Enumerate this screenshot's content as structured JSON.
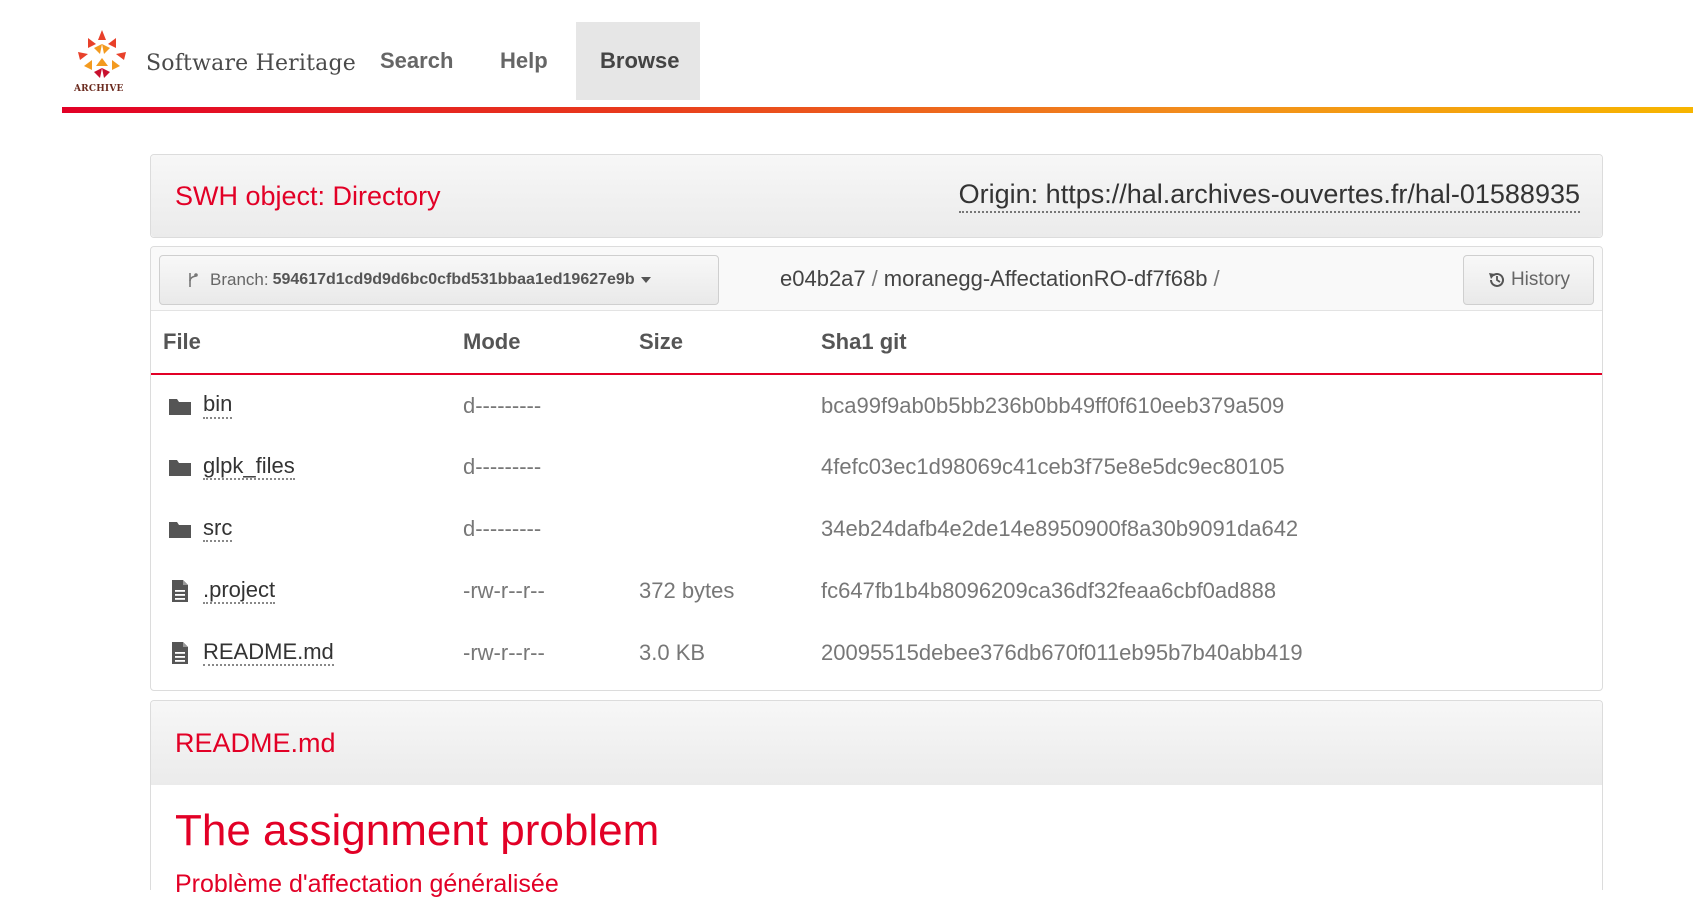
{
  "nav": {
    "brand_logo_text": "ARCHIVE",
    "brand_name": "Software Heritage",
    "items": [
      {
        "label": "Search",
        "active": false
      },
      {
        "label": "Help",
        "active": false
      },
      {
        "label": "Browse",
        "active": true
      }
    ]
  },
  "object": {
    "title": "SWH object: Directory",
    "origin": "Origin: https://hal.archives-ouvertes.fr/hal-01588935"
  },
  "toolbar": {
    "branch_prefix": "Branch:",
    "branch_id": "594617d1cd9d9d6bc0cfbd531bbaa1ed19627e9b",
    "breadcrumb": [
      "e04b2a7",
      "moranegg-AffectationRO-df7f68b"
    ],
    "breadcrumb_sep": "/",
    "history_label": "History"
  },
  "listing": {
    "headers": {
      "file": "File",
      "mode": "Mode",
      "size": "Size",
      "sha": "Sha1 git"
    },
    "rows": [
      {
        "type": "folder",
        "name": "bin",
        "mode": "d---------",
        "size": "",
        "sha": "bca99f9ab0b5bb236b0bb49ff0f610eeb379a509"
      },
      {
        "type": "folder",
        "name": "glpk_files",
        "mode": "d---------",
        "size": "",
        "sha": "4fefc03ec1d98069c41ceb3f75e8e5dc9ec80105"
      },
      {
        "type": "folder",
        "name": "src",
        "mode": "d---------",
        "size": "",
        "sha": "34eb24dafb4e2de14e8950900f8a30b9091da642"
      },
      {
        "type": "file",
        "name": ".project",
        "mode": "-rw-r--r--",
        "size": "372 bytes",
        "sha": "fc647fb1b4b8096209ca36df32feaa6cbf0ad888"
      },
      {
        "type": "file",
        "name": "README.md",
        "mode": "-rw-r--r--",
        "size": "3.0 KB",
        "sha": "20095515debee376db670f011eb95b7b40abb419"
      }
    ]
  },
  "readme": {
    "title": "README.md",
    "h1": "The assignment problem",
    "h2": "Problème d'affectation généralisée"
  },
  "colors": {
    "accent": "#e20026",
    "gradient_end": "#f7b500"
  },
  "icons": {
    "logo": "swh-logo-icon",
    "branch": "code-fork-icon",
    "history": "history-icon",
    "folder": "folder-icon",
    "file": "file-text-icon"
  }
}
